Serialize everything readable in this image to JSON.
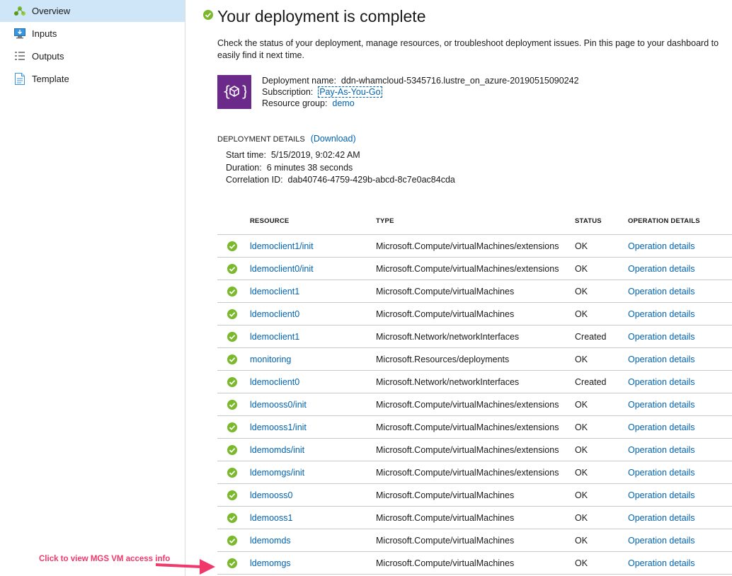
{
  "sidebar": {
    "items": [
      {
        "label": "Overview",
        "icon": "overview-icon",
        "active": true
      },
      {
        "label": "Inputs",
        "icon": "inputs-icon",
        "active": false
      },
      {
        "label": "Outputs",
        "icon": "outputs-icon",
        "active": false
      },
      {
        "label": "Template",
        "icon": "template-icon",
        "active": false
      }
    ]
  },
  "header": {
    "title": "Your deployment is complete",
    "description_line1": "Check the status of your deployment, manage resources, or troubleshoot deployment issues. Pin this page to your dashboard to",
    "description_line2": "easily find it next time."
  },
  "deployment": {
    "name_label": "Deployment name:",
    "name_value": "ddn-whamcloud-5345716.lustre_on_azure-20190515090242",
    "subscription_label": "Subscription:",
    "subscription_value": "Pay-As-You-Go",
    "resource_group_label": "Resource group:",
    "resource_group_value": "demo"
  },
  "details": {
    "heading": "DEPLOYMENT DETAILS",
    "download_label": "(Download)",
    "start_time_label": "Start time:",
    "start_time_value": "5/15/2019, 9:02:42 AM",
    "duration_label": "Duration:",
    "duration_value": "6 minutes 38 seconds",
    "correlation_label": "Correlation ID:",
    "correlation_value": "dab40746-4759-429b-abcd-8c7e0ac84cda"
  },
  "table": {
    "headers": {
      "resource": "RESOURCE",
      "type": "TYPE",
      "status": "STATUS",
      "operation": "OPERATION DETAILS"
    },
    "rows": [
      {
        "resource": "ldemoclient1/init",
        "type": "Microsoft.Compute/virtualMachines/extensions",
        "status": "OK",
        "op": "Operation details"
      },
      {
        "resource": "ldemoclient0/init",
        "type": "Microsoft.Compute/virtualMachines/extensions",
        "status": "OK",
        "op": "Operation details"
      },
      {
        "resource": "ldemoclient1",
        "type": "Microsoft.Compute/virtualMachines",
        "status": "OK",
        "op": "Operation details"
      },
      {
        "resource": "ldemoclient0",
        "type": "Microsoft.Compute/virtualMachines",
        "status": "OK",
        "op": "Operation details"
      },
      {
        "resource": "ldemoclient1",
        "type": "Microsoft.Network/networkInterfaces",
        "status": "Created",
        "op": "Operation details"
      },
      {
        "resource": "monitoring",
        "type": "Microsoft.Resources/deployments",
        "status": "OK",
        "op": "Operation details"
      },
      {
        "resource": "ldemoclient0",
        "type": "Microsoft.Network/networkInterfaces",
        "status": "Created",
        "op": "Operation details"
      },
      {
        "resource": "ldemooss0/init",
        "type": "Microsoft.Compute/virtualMachines/extensions",
        "status": "OK",
        "op": "Operation details"
      },
      {
        "resource": "ldemooss1/init",
        "type": "Microsoft.Compute/virtualMachines/extensions",
        "status": "OK",
        "op": "Operation details"
      },
      {
        "resource": "ldemomds/init",
        "type": "Microsoft.Compute/virtualMachines/extensions",
        "status": "OK",
        "op": "Operation details"
      },
      {
        "resource": "ldemomgs/init",
        "type": "Microsoft.Compute/virtualMachines/extensions",
        "status": "OK",
        "op": "Operation details"
      },
      {
        "resource": "ldemooss0",
        "type": "Microsoft.Compute/virtualMachines",
        "status": "OK",
        "op": "Operation details"
      },
      {
        "resource": "ldemooss1",
        "type": "Microsoft.Compute/virtualMachines",
        "status": "OK",
        "op": "Operation details"
      },
      {
        "resource": "ldemomds",
        "type": "Microsoft.Compute/virtualMachines",
        "status": "OK",
        "op": "Operation details"
      },
      {
        "resource": "ldemomgs",
        "type": "Microsoft.Compute/virtualMachines",
        "status": "OK",
        "op": "Operation details"
      }
    ]
  },
  "annotation": {
    "text": "Click to view MGS VM access info"
  },
  "colors": {
    "accent": "#0063b1",
    "success": "#7ab929",
    "active_nav": "#cfe6f8",
    "logo_bg": "#6b2a8a",
    "annotation": "#f0386b"
  }
}
